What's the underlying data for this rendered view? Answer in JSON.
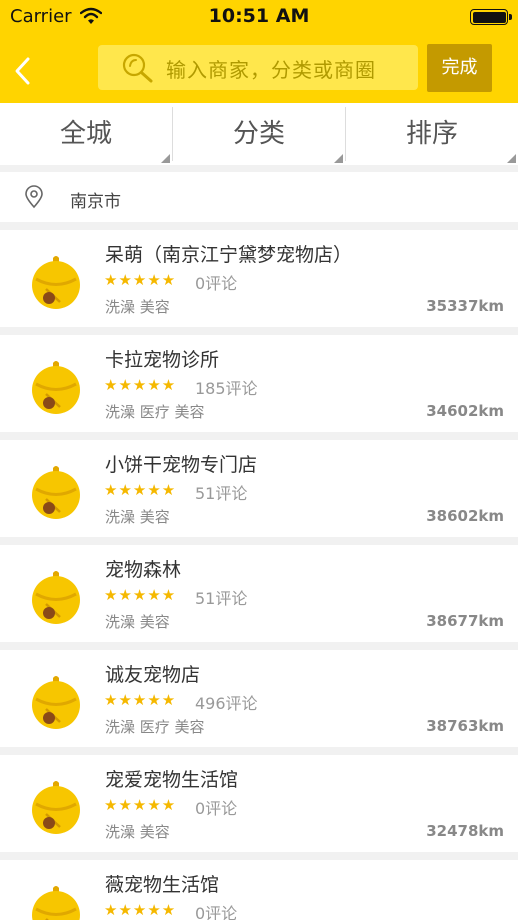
{
  "status_bar": {
    "carrier": "Carrier",
    "time": "10:51 AM"
  },
  "header": {
    "search_placeholder": "输入商家，分类或商圈",
    "done_label": "完成",
    "accent_color": "#ffd400"
  },
  "filters": [
    {
      "label": "全城"
    },
    {
      "label": "分类"
    },
    {
      "label": "排序"
    }
  ],
  "location": {
    "city": "南京市"
  },
  "shops": [
    {
      "name": "呆萌（南京江宁黛梦宠物店）",
      "stars": "★★★★★",
      "reviews": "0评论",
      "tags": "洗澡 美容",
      "distance": "35337km"
    },
    {
      "name": "卡拉宠物诊所",
      "stars": "★★★★★",
      "reviews": "185评论",
      "tags": "洗澡 医疗 美容",
      "distance": "34602km"
    },
    {
      "name": "小饼干宠物专门店",
      "stars": "★★★★★",
      "reviews": "51评论",
      "tags": "洗澡 美容",
      "distance": "38602km"
    },
    {
      "name": "宠物森林",
      "stars": "★★★★★",
      "reviews": "51评论",
      "tags": "洗澡 美容",
      "distance": "38677km"
    },
    {
      "name": "诚友宠物店",
      "stars": "★★★★★",
      "reviews": "496评论",
      "tags": "洗澡 医疗 美容",
      "distance": "38763km"
    },
    {
      "name": "宠爱宠物生活馆",
      "stars": "★★★★★",
      "reviews": "0评论",
      "tags": "洗澡 美容",
      "distance": "32478km"
    },
    {
      "name": "薇宠物生活馆",
      "stars": "★★★★★",
      "reviews": "0评论",
      "tags": "",
      "distance": ""
    }
  ]
}
